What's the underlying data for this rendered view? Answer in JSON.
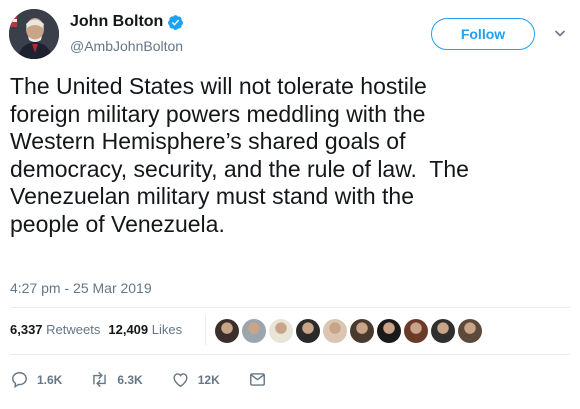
{
  "author": {
    "name": "John Bolton",
    "handle": "@AmbJohnBolton"
  },
  "follow_label": "Follow",
  "tweet": {
    "text": "The United States will not tolerate hostile\nforeign military powers meddling with the\nWestern Hemisphere’s shared goals of\ndemocracy, security, and the rule of law.  The\nVenezuelan military must stand with the\npeople of Venezuela.",
    "timestamp": "4:27 pm - 25 Mar 2019"
  },
  "stats": {
    "retweets_count": "6,337",
    "retweets_label": "Retweets",
    "likes_count": "12,409",
    "likes_label": "Likes"
  },
  "liker_avatars": [
    {
      "name": "liker-avatar-1",
      "color": "#3a2f2a"
    },
    {
      "name": "liker-avatar-2",
      "color": "#9aa5ae"
    },
    {
      "name": "liker-avatar-3",
      "color": "#e8e4d8"
    },
    {
      "name": "liker-avatar-4",
      "color": "#2a2a2a"
    },
    {
      "name": "liker-avatar-5",
      "color": "#d9c5b2"
    },
    {
      "name": "liker-avatar-6",
      "color": "#4a3a2e"
    },
    {
      "name": "liker-avatar-7",
      "color": "#1a1a1a"
    },
    {
      "name": "liker-avatar-8",
      "color": "#6b3b2a"
    },
    {
      "name": "liker-avatar-9",
      "color": "#2f2f2f"
    },
    {
      "name": "liker-avatar-10",
      "color": "#5b4a3a"
    }
  ],
  "actions": {
    "replies": "1.6K",
    "retweets": "6.3K",
    "likes": "12K"
  },
  "colors": {
    "accent": "#1da1f2",
    "muted": "#657786",
    "text": "#14171a",
    "divider": "#e6ecf0"
  },
  "icons": [
    "verified-badge-icon",
    "chevron-down-icon",
    "reply-icon",
    "retweet-icon",
    "like-icon",
    "direct-message-icon"
  ]
}
